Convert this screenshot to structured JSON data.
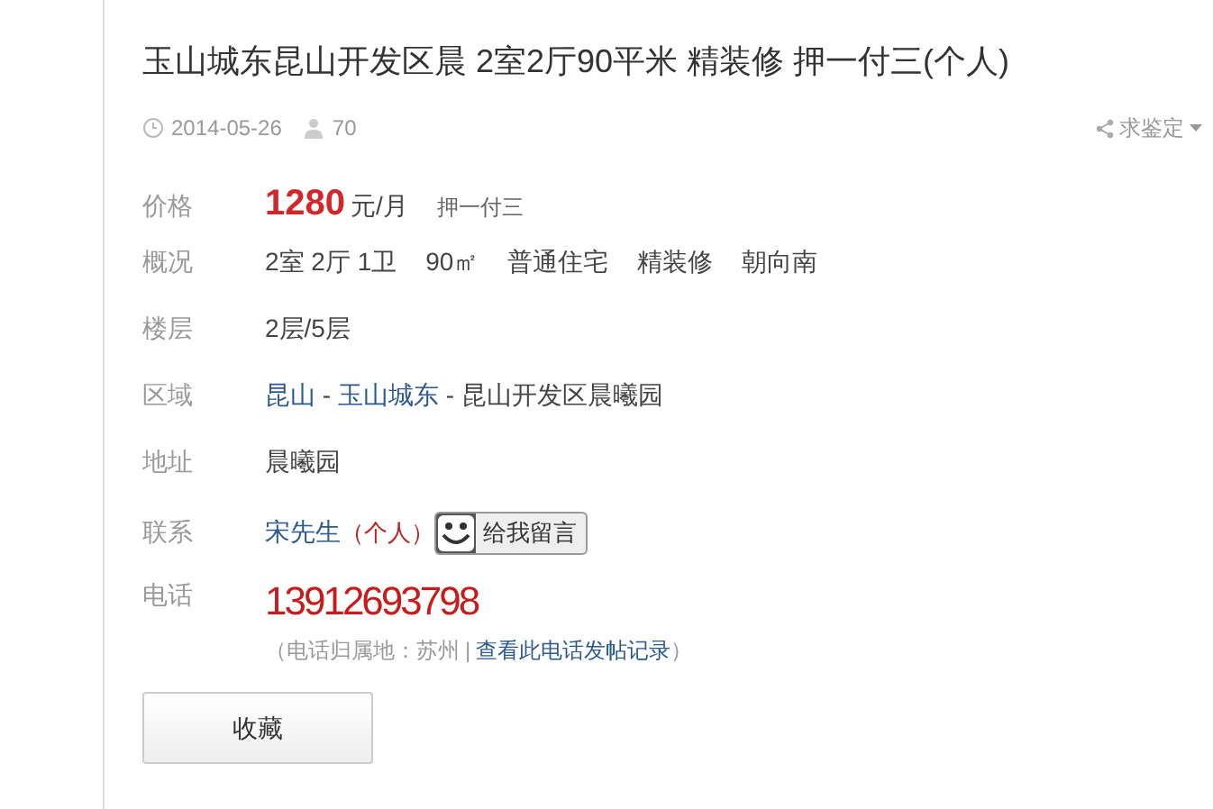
{
  "title": "玉山城东昆山开发区晨 2室2厅90平米 精装修 押一付三(个人)",
  "meta": {
    "date": "2014-05-26",
    "views": "70",
    "appraise": "求鉴定"
  },
  "price": {
    "label": "价格",
    "amount": "1280",
    "unit": "元/月",
    "payment": "押一付三"
  },
  "overview": {
    "label": "概况",
    "items": [
      "2室 2厅 1卫",
      "90㎡",
      "普通住宅",
      "精装修",
      "朝向南"
    ]
  },
  "floor": {
    "label": "楼层",
    "value": "2层/5层"
  },
  "region": {
    "label": "区域",
    "parts": [
      {
        "text": "昆山",
        "kind": "link"
      },
      {
        "text": " - ",
        "kind": "text"
      },
      {
        "text": "玉山城东",
        "kind": "link"
      },
      {
        "text": " - 昆山开发区晨曦园",
        "kind": "text"
      }
    ]
  },
  "address": {
    "label": "地址",
    "value": "晨曦园"
  },
  "contact": {
    "label": "联系",
    "name": "宋先生",
    "type": "（个人）",
    "message_button": "给我留言"
  },
  "phone": {
    "label": "电话",
    "number": "13912693798",
    "location": "（电话归属地：苏州",
    "separator": "|",
    "history_link": "查看此电话发帖记录",
    "close": "）"
  },
  "favorite_button": "收藏"
}
